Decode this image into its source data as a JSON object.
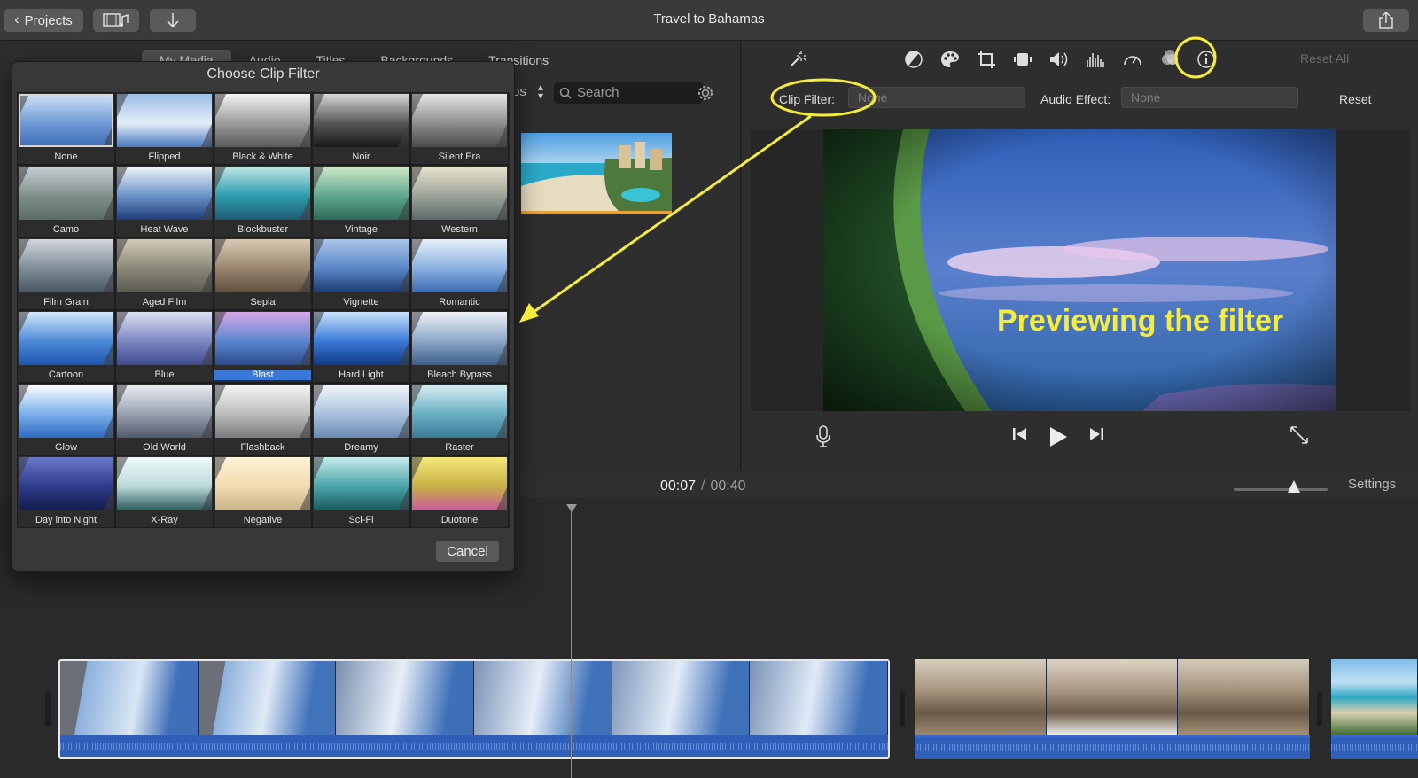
{
  "titlebar": {
    "projects_label": "Projects",
    "window_title": "Travel to Bahamas"
  },
  "browser": {
    "tabs": [
      {
        "label": "My Media"
      },
      {
        "label": "Audio"
      },
      {
        "label": "Titles"
      },
      {
        "label": "Backgrounds"
      },
      {
        "label": "Transitions"
      }
    ],
    "clips_partial": "ps",
    "search_placeholder": "Search"
  },
  "viewer": {
    "reset_all_label": "Reset All",
    "clip_filter_label": "Clip Filter:",
    "clip_filter_value": "None",
    "audio_effect_label": "Audio Effect:",
    "audio_effect_value": "None",
    "reset_label": "Reset",
    "annotation_text": "Previewing the filter"
  },
  "timeline": {
    "current_time": "00:07",
    "separator": "/",
    "total_time": "00:40",
    "settings_label": "Settings"
  },
  "dialog": {
    "title": "Choose Clip Filter",
    "cancel_label": "Cancel",
    "filters": [
      {
        "name": "None",
        "style": "sky"
      },
      {
        "name": "Flipped",
        "style": "flip"
      },
      {
        "name": "Black & White",
        "style": "bw"
      },
      {
        "name": "Noir",
        "style": "noir"
      },
      {
        "name": "Silent Era",
        "style": "silent"
      },
      {
        "name": "Camo",
        "style": "camo"
      },
      {
        "name": "Heat Wave",
        "style": "heat"
      },
      {
        "name": "Blockbuster",
        "style": "block"
      },
      {
        "name": "Vintage",
        "style": "vintage"
      },
      {
        "name": "Western",
        "style": "western"
      },
      {
        "name": "Film Grain",
        "style": "grain"
      },
      {
        "name": "Aged Film",
        "style": "aged"
      },
      {
        "name": "Sepia",
        "style": "sepia"
      },
      {
        "name": "Vignette",
        "style": "vig"
      },
      {
        "name": "Romantic",
        "style": "romantic"
      },
      {
        "name": "Cartoon",
        "style": "cartoon"
      },
      {
        "name": "Blue",
        "style": "blue"
      },
      {
        "name": "Blast",
        "style": "blast"
      },
      {
        "name": "Hard Light",
        "style": "hard"
      },
      {
        "name": "Bleach Bypass",
        "style": "bleach"
      },
      {
        "name": "Glow",
        "style": "glow"
      },
      {
        "name": "Old World",
        "style": "old"
      },
      {
        "name": "Flashback",
        "style": "flash"
      },
      {
        "name": "Dreamy",
        "style": "dreamy"
      },
      {
        "name": "Raster",
        "style": "raster"
      },
      {
        "name": "Day into Night",
        "style": "night"
      },
      {
        "name": "X-Ray",
        "style": "xray"
      },
      {
        "name": "Negative",
        "style": "neg"
      },
      {
        "name": "Sci-Fi",
        "style": "scifi"
      },
      {
        "name": "Duotone",
        "style": "duo"
      }
    ],
    "current_index": 0,
    "selected_index": 17
  },
  "colors": {
    "annotation": "#f5ec3b",
    "selection": "#3a78d8",
    "clip_trim": "#e8a13a"
  }
}
